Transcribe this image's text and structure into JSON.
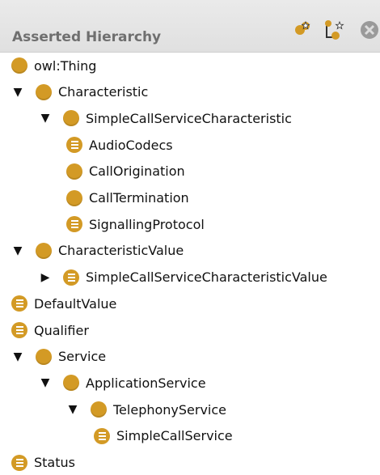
{
  "panel": {
    "title": "Asserted Hierarchy",
    "toolbar": [
      {
        "name": "add-subclass-icon"
      },
      {
        "name": "add-sibling-class-icon"
      },
      {
        "name": "delete-class-icon"
      }
    ]
  },
  "tree": [
    {
      "label": "owl:Thing",
      "depth": 0,
      "toggle": "none",
      "icon": "plain",
      "tag": "owl-thing"
    },
    {
      "label": "Characteristic",
      "depth": 0,
      "toggle": "expanded",
      "icon": "plain",
      "tag": "characteristic"
    },
    {
      "label": "SimpleCallServiceCharacteristic",
      "depth": 1,
      "toggle": "expanded",
      "icon": "plain",
      "tag": "simplecallservicecharacteristic"
    },
    {
      "label": "AudioCodecs",
      "depth": 2,
      "toggle": "none",
      "icon": "defined",
      "tag": "audiocodecs"
    },
    {
      "label": "CallOrigination",
      "depth": 2,
      "toggle": "none",
      "icon": "plain",
      "tag": "callorigination"
    },
    {
      "label": "CallTermination",
      "depth": 2,
      "toggle": "none",
      "icon": "plain",
      "tag": "calltermination"
    },
    {
      "label": "SignallingProtocol",
      "depth": 2,
      "toggle": "none",
      "icon": "defined",
      "tag": "signallingprotocol"
    },
    {
      "label": "CharacteristicValue",
      "depth": 0,
      "toggle": "expanded",
      "icon": "plain",
      "tag": "characteristicvalue"
    },
    {
      "label": "SimpleCallServiceCharacteristicValue",
      "depth": 1,
      "toggle": "collapsed",
      "icon": "defined",
      "tag": "simplecallservicecharacteristicvalue"
    },
    {
      "label": "DefaultValue",
      "depth": 0,
      "toggle": "none",
      "icon": "defined",
      "tag": "defaultvalue"
    },
    {
      "label": "Qualifier",
      "depth": 0,
      "toggle": "none",
      "icon": "defined",
      "tag": "qualifier"
    },
    {
      "label": "Service",
      "depth": 0,
      "toggle": "expanded",
      "icon": "plain",
      "tag": "service"
    },
    {
      "label": "ApplicationService",
      "depth": 1,
      "toggle": "expanded",
      "icon": "plain",
      "tag": "applicationservice"
    },
    {
      "label": "TelephonyService",
      "depth": 2,
      "toggle": "expanded",
      "icon": "plain",
      "tag": "telephonyservice"
    },
    {
      "label": "SimpleCallService",
      "depth": 3,
      "toggle": "none",
      "icon": "defined",
      "tag": "simplecallservice"
    },
    {
      "label": "Status",
      "depth": 0,
      "toggle": "none",
      "icon": "defined",
      "tag": "status"
    }
  ]
}
